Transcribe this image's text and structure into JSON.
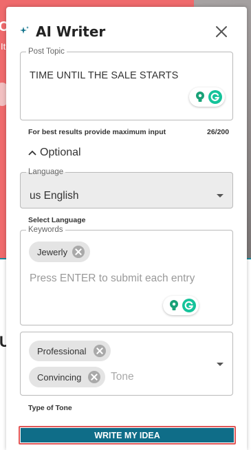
{
  "background": {
    "fragment_1": "C",
    "fragment_2": "It",
    "fragment_3": "U"
  },
  "panel": {
    "title": "AI Writer",
    "title_icon": "sparkle-icon",
    "close_icon": "close-icon"
  },
  "post_topic": {
    "legend": "Post Topic",
    "value": "TIME UNTIL THE SALE STARTS",
    "hint": "For best results provide maximum input",
    "counter": "26/200",
    "tools": [
      "lightbulb-icon",
      "grammarly-icon"
    ]
  },
  "optional": {
    "label": "Optional",
    "icon": "chevron-up-icon"
  },
  "language": {
    "legend": "Language",
    "value": "us English",
    "helper": "Select Language"
  },
  "keywords": {
    "legend": "Keywords",
    "chips": [
      "Jewerly"
    ],
    "placeholder": "Press ENTER to submit each entry"
  },
  "tone": {
    "chips": [
      "Professional",
      "Convincing"
    ],
    "placeholder": "Tone",
    "helper": "Type of Tone"
  },
  "submit": {
    "label": "WRITE MY IDEA"
  },
  "colors": {
    "accent": "#0f6d88",
    "background_banner": "#ef6a6c",
    "button_outline": "#e05656"
  }
}
